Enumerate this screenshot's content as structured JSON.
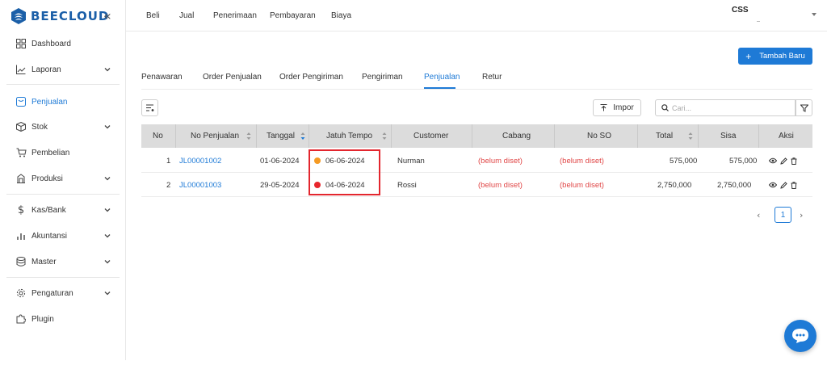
{
  "brand": {
    "name": "BEECLOUD"
  },
  "colors": {
    "accent": "#1e7ad6",
    "danger": "#e04646",
    "highlight": "#e3262e",
    "dot_orange": "#f59a23",
    "dot_red": "#e8262c"
  },
  "sidebar": {
    "items": [
      {
        "label": "Dashboard",
        "icon": "grid-icon"
      },
      {
        "label": "Laporan",
        "icon": "chart-line-icon"
      },
      {
        "label": "Penjualan",
        "icon": "receipt-icon"
      },
      {
        "label": "Stok",
        "icon": "box-icon"
      },
      {
        "label": "Pembelian",
        "icon": "cart-icon"
      },
      {
        "label": "Produksi",
        "icon": "factory-icon"
      },
      {
        "label": "Kas/Bank",
        "icon": "dollar-icon"
      },
      {
        "label": "Akuntansi",
        "icon": "bar-chart-icon"
      },
      {
        "label": "Master",
        "icon": "database-icon"
      },
      {
        "label": "Pengaturan",
        "icon": "gear-icon"
      },
      {
        "label": "Plugin",
        "icon": "puzzle-icon"
      }
    ]
  },
  "topnav": {
    "items": [
      "Beli",
      "Jual",
      "Penerimaan",
      "Pembayaran",
      "Biaya"
    ],
    "user": "CSS"
  },
  "main": {
    "add_button": "Tambah Baru",
    "tabs": [
      "Penawaran",
      "Order Penjualan",
      "Order Pengiriman",
      "Pengiriman",
      "Penjualan",
      "Retur"
    ],
    "active_tab": "Penjualan",
    "import_label": "Impor",
    "search_placeholder": "Cari..."
  },
  "table": {
    "headers": [
      "No",
      "No Penjualan",
      "Tanggal",
      "Jatuh Tempo",
      "Customer",
      "Cabang",
      "No SO",
      "Total",
      "Sisa",
      "Aksi"
    ],
    "rows": [
      {
        "no": "1",
        "no_penjualan": "JL00001002",
        "tanggal": "01-06-2024",
        "jatuh_tempo": "06-06-2024",
        "due_status": "orange",
        "customer": "Nurman",
        "cabang": "(belum diset)",
        "no_so": "(belum diset)",
        "total": "575,000",
        "sisa": "575,000"
      },
      {
        "no": "2",
        "no_penjualan": "JL00001003",
        "tanggal": "29-05-2024",
        "jatuh_tempo": "04-06-2024",
        "due_status": "red",
        "customer": "Rossi",
        "cabang": "(belum diset)",
        "no_so": "(belum diset)",
        "total": "2,750,000",
        "sisa": "2,750,000"
      }
    ]
  },
  "pagination": {
    "current_page": "1"
  }
}
